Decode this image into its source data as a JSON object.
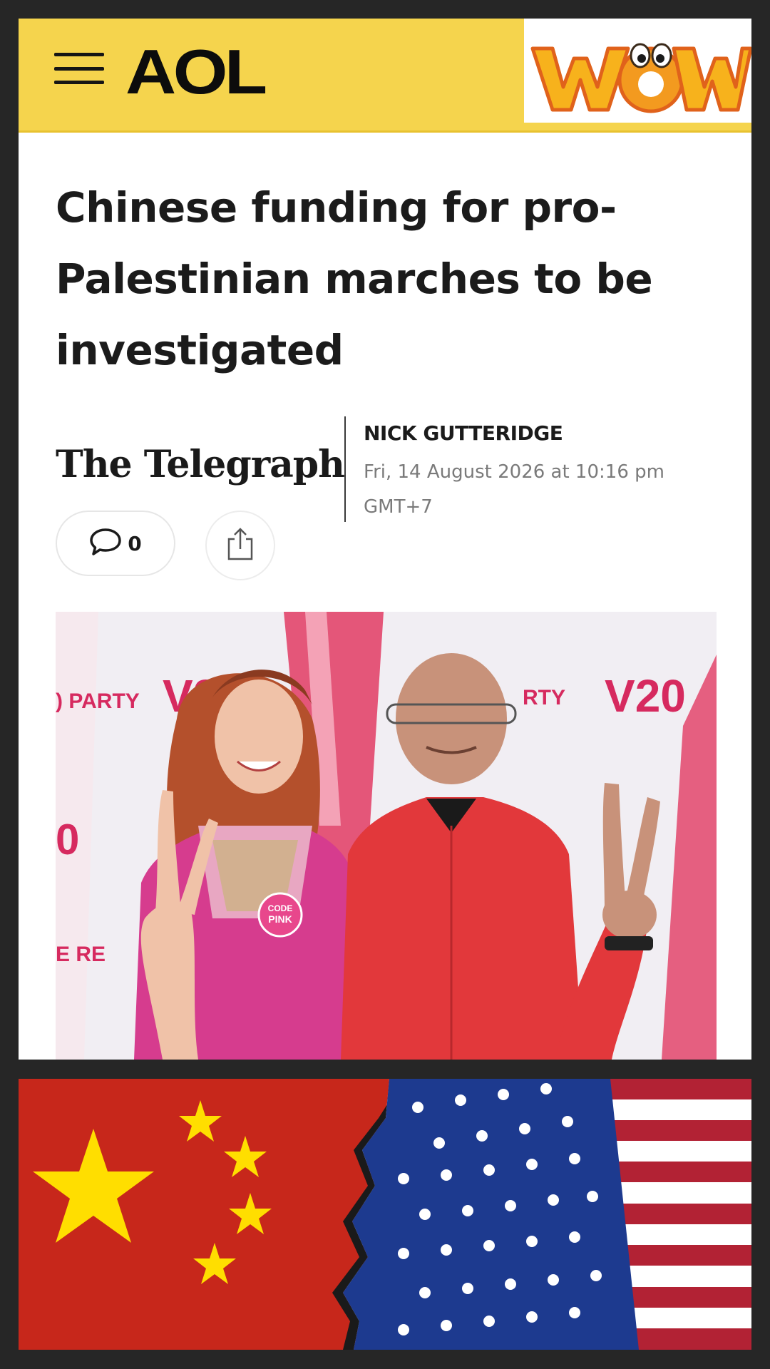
{
  "header": {
    "brand": "AOL",
    "watermark": "WOW",
    "background_color": "#f5d44d"
  },
  "article": {
    "headline_lines": [
      "Chinese funding for pro-",
      "Palestinian marches to be",
      "investigated"
    ],
    "publisher": "The Telegraph",
    "author": "NICK GUTTERIDGE",
    "date_line_1": "Fri, 14 August 2026 at 10:16 pm",
    "date_line_2": "GMT+7",
    "comment_count": "0"
  },
  "photo": {
    "backdrop_text": {
      "left_party": ") PARTY",
      "left_v": "V2",
      "center_party": "RTY",
      "right_v": "V20",
      "left_digit": "0",
      "left_re": "E RE"
    },
    "badge_line_1": "CODE",
    "badge_line_2": "PINK"
  },
  "icons": {
    "menu": "hamburger-menu-icon",
    "comment": "comment-bubble-icon",
    "share": "share-upload-icon"
  },
  "colors": {
    "china_red": "#d52b1e",
    "china_star": "#ffde00",
    "usa_blue": "#1d3a8f",
    "usa_red": "#b22234"
  }
}
